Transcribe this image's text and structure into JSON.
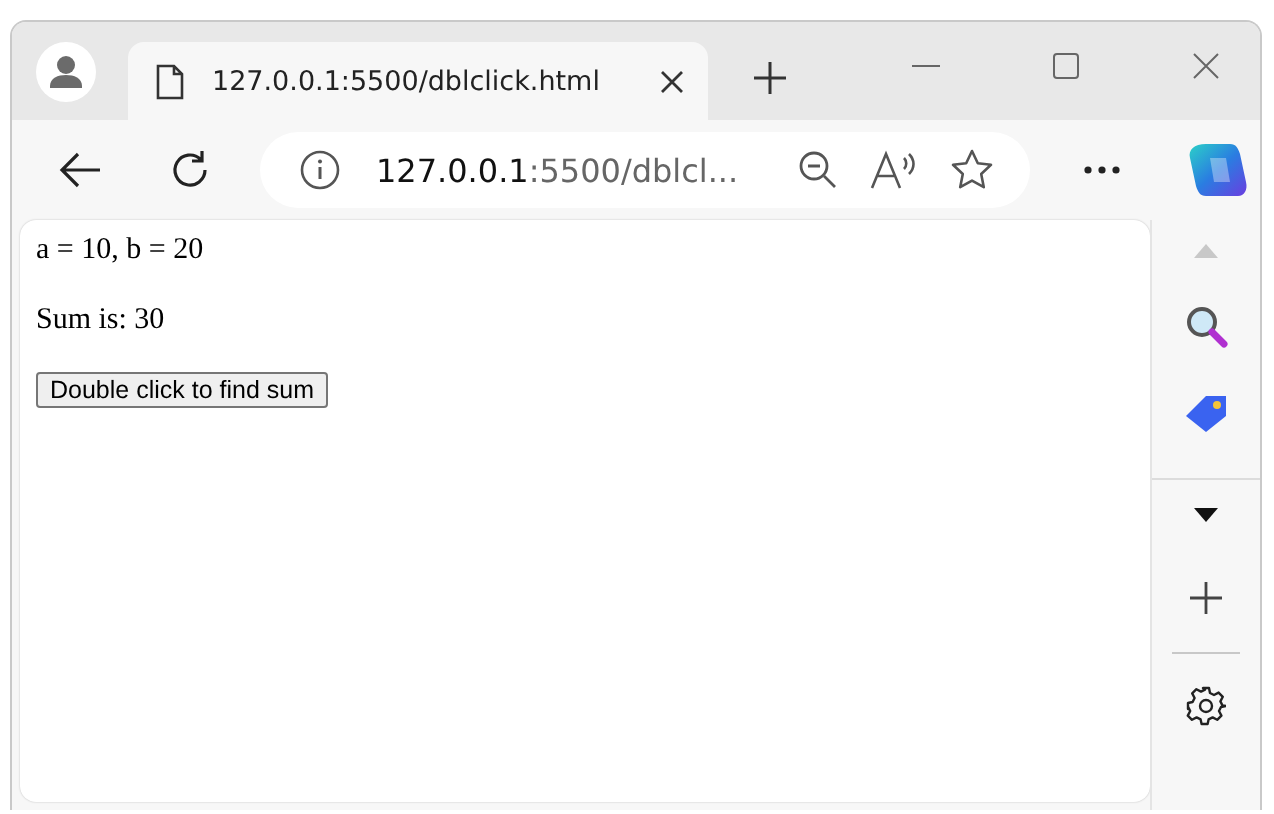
{
  "tab": {
    "title": "127.0.0.1:5500/dblclick.html"
  },
  "address": {
    "host": "127.0.0.1",
    "rest": ":5500/dblcl..."
  },
  "page": {
    "lines": [
      "a = 10, b = 20",
      "Sum is: 30"
    ],
    "button": "Double click to find sum"
  }
}
